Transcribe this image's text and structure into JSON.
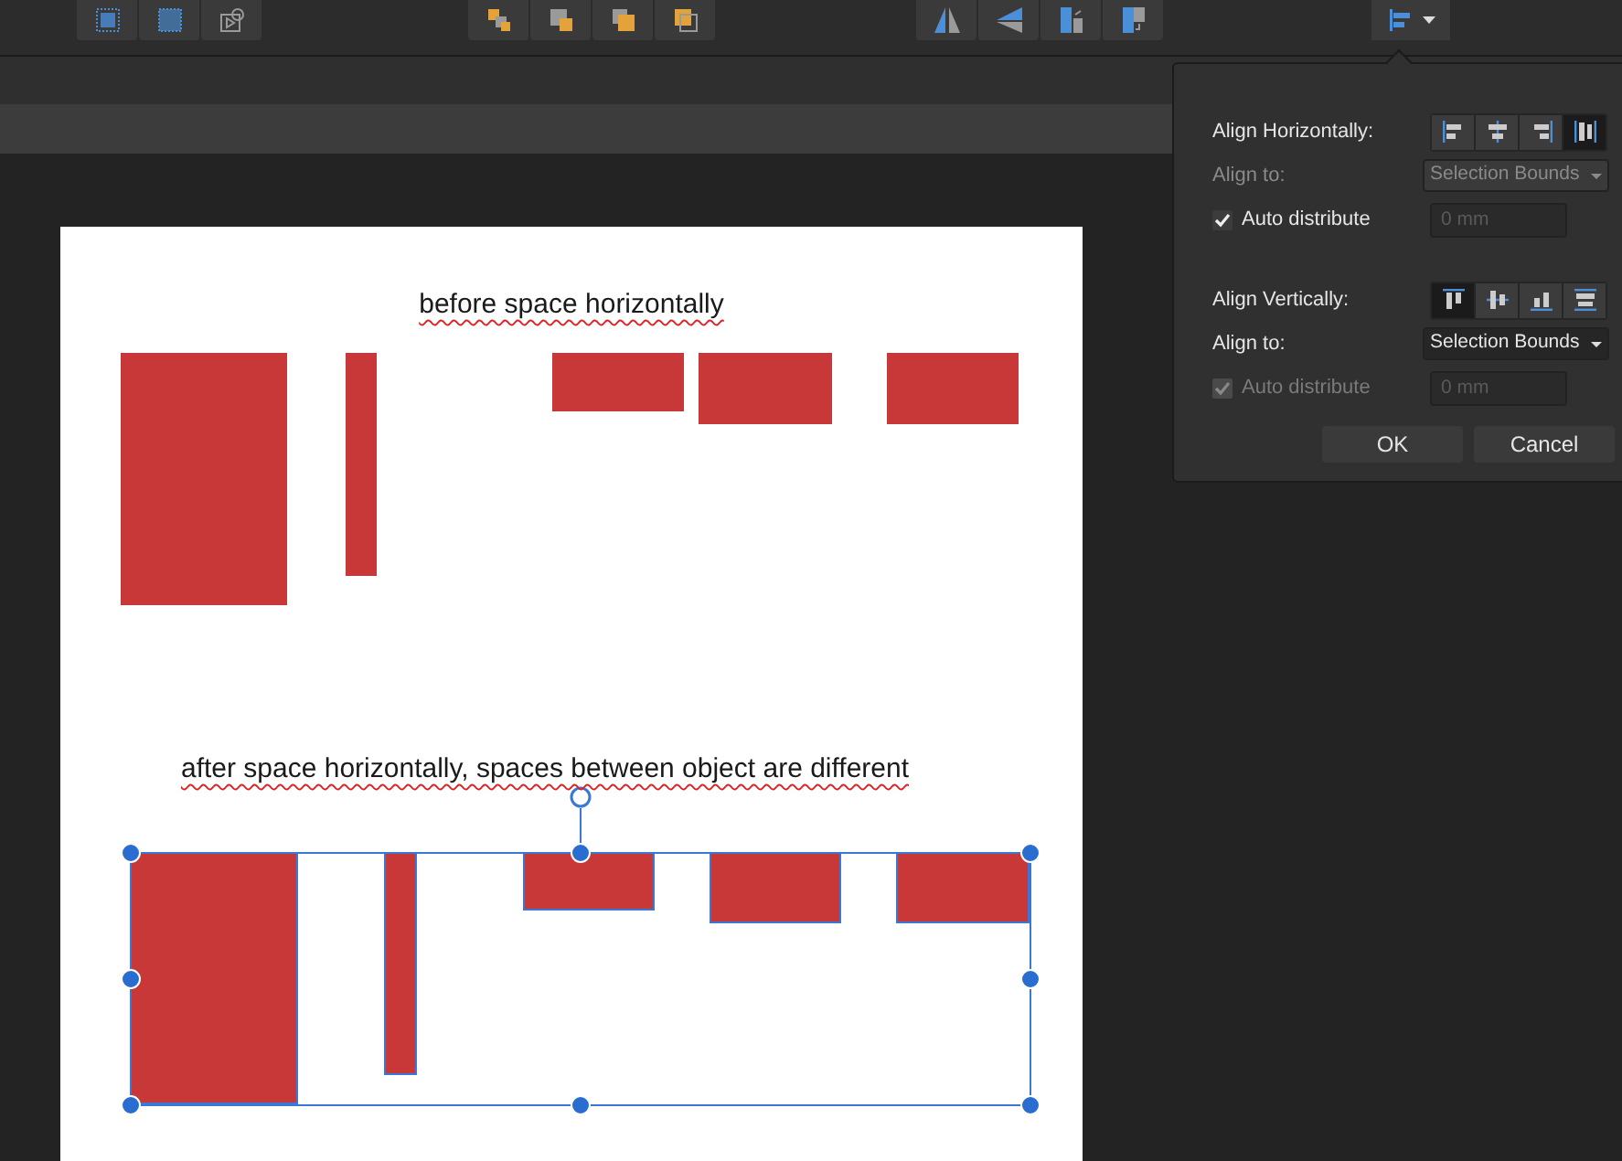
{
  "canvas": {
    "captions": [
      {
        "text": "before space horizontally",
        "misspelled": true
      },
      {
        "text": "after space horizontally, spaces between object are different",
        "misspelled": true
      }
    ]
  },
  "align_panel": {
    "horizontal": {
      "label": "Align Horizontally:",
      "buttons": [
        {
          "selected": false
        },
        {
          "selected": false
        },
        {
          "selected": false
        },
        {
          "selected": true
        }
      ],
      "align_to": {
        "label": "Align to:",
        "value": "Selection Bounds",
        "disabled": true
      },
      "auto_distribute": {
        "label": "Auto distribute",
        "checked": true,
        "disabled": false
      },
      "spacing": {
        "placeholder": "0 mm"
      }
    },
    "vertical": {
      "label": "Align Vertically:",
      "buttons": [
        {
          "selected": true
        },
        {
          "selected": false
        },
        {
          "selected": false
        },
        {
          "selected": false
        }
      ],
      "align_to": {
        "label": "Align to:",
        "value": "Selection Bounds",
        "disabled": false
      },
      "auto_distribute": {
        "label": "Auto distribute",
        "checked": true,
        "disabled": true
      },
      "spacing": {
        "placeholder": "0 mm"
      }
    },
    "buttons": [
      "OK",
      "Cancel"
    ]
  }
}
